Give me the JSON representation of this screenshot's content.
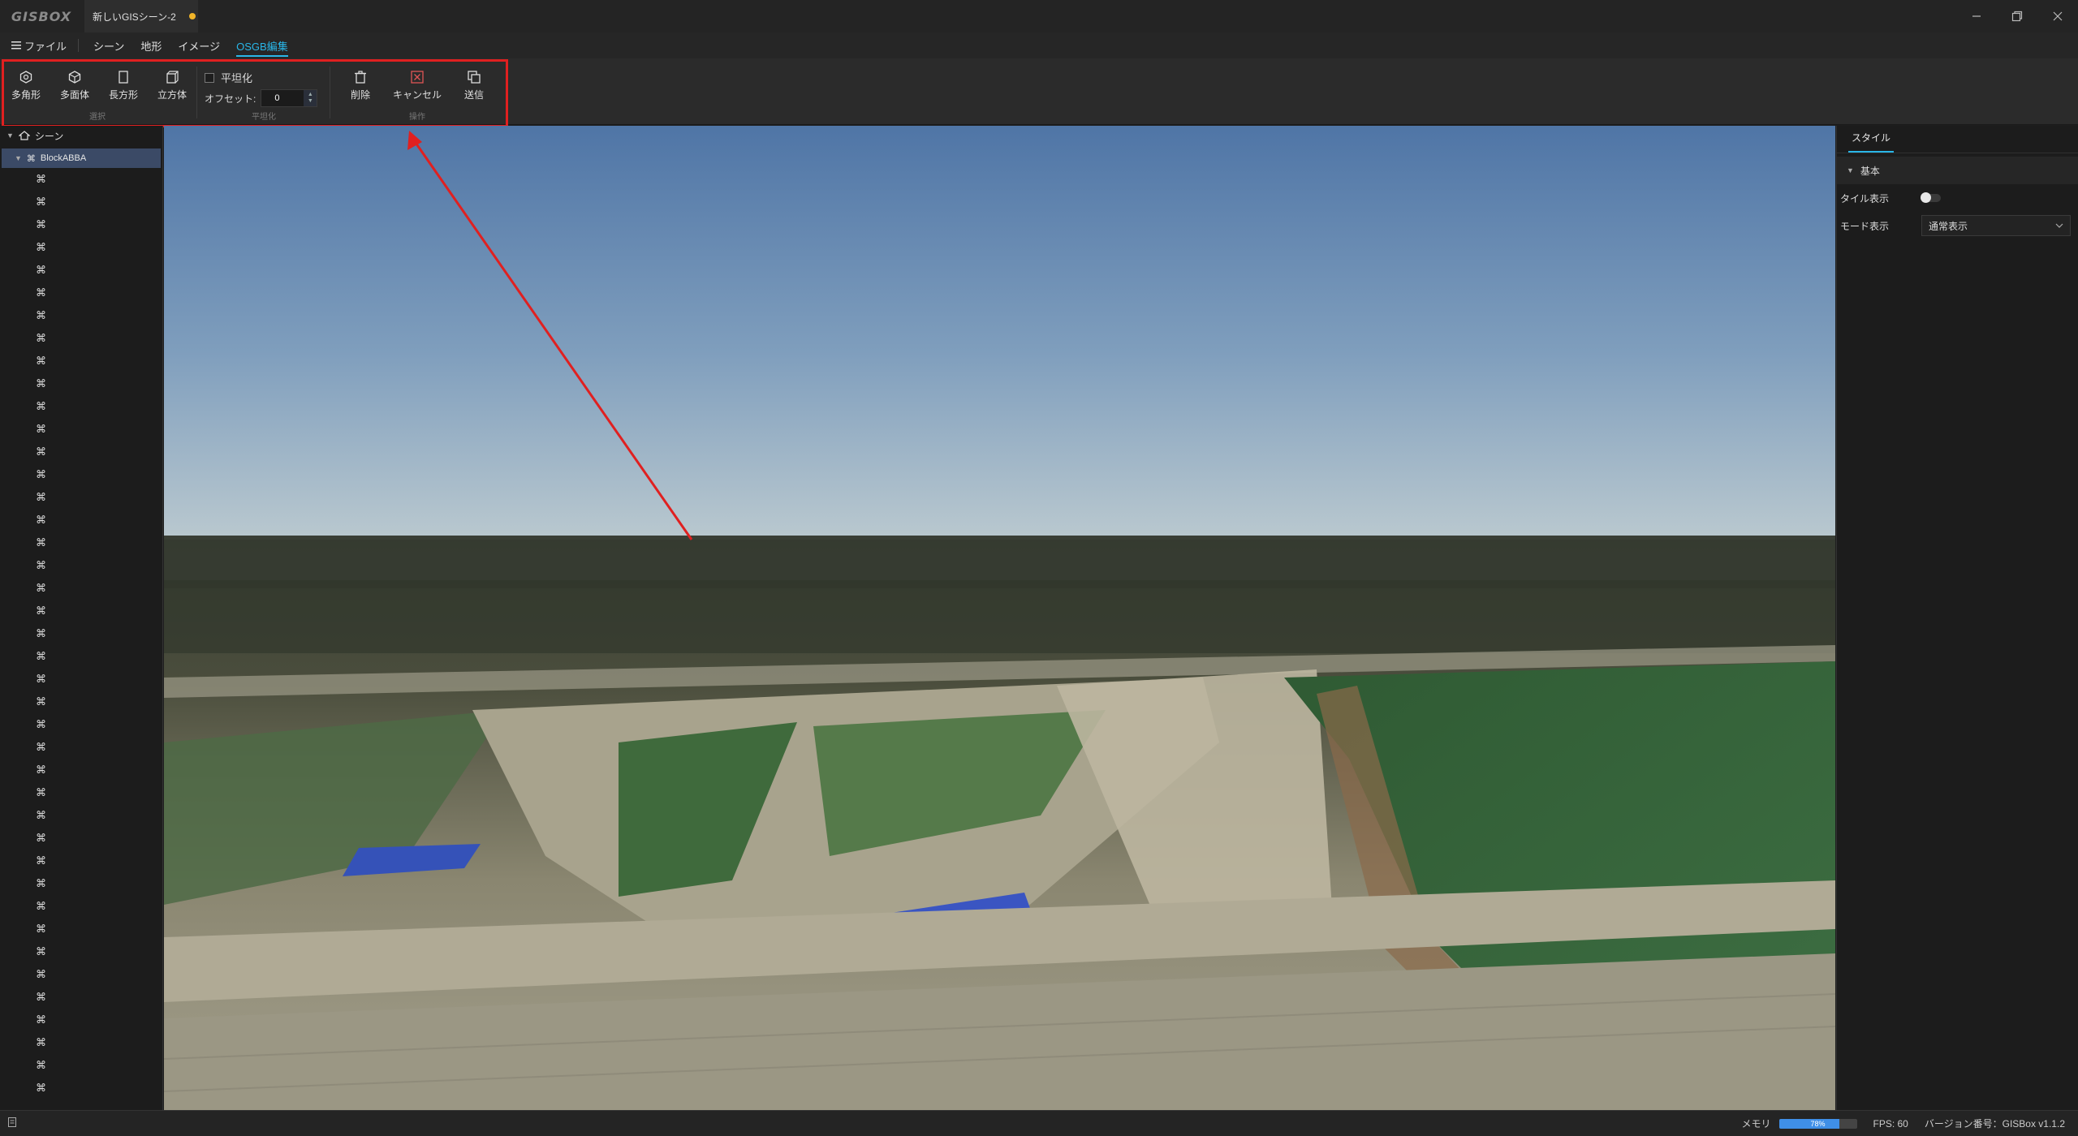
{
  "app": {
    "logo": "GISBOX",
    "doc_tab": "新しいGISシーン-2",
    "window_controls": [
      "minimize-icon",
      "restore-icon",
      "close-icon"
    ]
  },
  "menu": {
    "file": "ファイル",
    "tabs": [
      {
        "label": "シーン",
        "active": false
      },
      {
        "label": "地形",
        "active": false
      },
      {
        "label": "イメージ",
        "active": false
      },
      {
        "label": "OSGB編集",
        "active": true
      }
    ]
  },
  "ribbon": {
    "draw_group": {
      "label": "選択",
      "tools": [
        {
          "label": "多角形",
          "icon": "polygon-icon"
        },
        {
          "label": "多面体",
          "icon": "polyhedron-icon"
        },
        {
          "label": "長方形",
          "icon": "rectangle-icon"
        },
        {
          "label": "立方体",
          "icon": "cube-icon"
        }
      ]
    },
    "flatten_group": {
      "label": "平坦化",
      "checkbox_label": "平坦化",
      "checked": false,
      "offset_label": "オフセット:",
      "offset_value": "0"
    },
    "ops_group": {
      "label": "操作",
      "tools": [
        {
          "label": "削除",
          "icon": "trash-icon"
        },
        {
          "label": "キャンセル",
          "icon": "cancel-icon"
        },
        {
          "label": "送信",
          "icon": "send-icon"
        }
      ]
    },
    "highlight_color": "#e02020"
  },
  "tree": {
    "root_label": "シーン",
    "selected_label": "BlockABBA",
    "child_count_visible": 41,
    "child_icon": "block-icon"
  },
  "right_panel": {
    "tab": "スタイル",
    "section": "基本",
    "tile_display_label": "タイル表示",
    "tile_display_on": false,
    "mode_label": "モード表示",
    "mode_value": "通常表示"
  },
  "status": {
    "memory_label": "メモリ",
    "memory_percent": 78,
    "memory_text": "78%",
    "fps": "FPS: 60",
    "version": "バージョン番号：GISBox v1.1.2"
  },
  "colors": {
    "accent": "#29b6e8",
    "selection": "#3b4a66",
    "annotation": "#e02020"
  }
}
